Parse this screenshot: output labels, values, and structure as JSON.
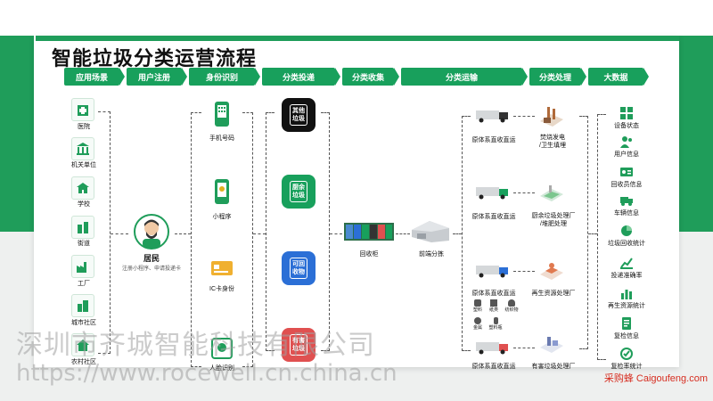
{
  "title": "智能垃圾分类运营流程",
  "colors": {
    "green": "#18a05c",
    "dark": "#111111",
    "blue": "#2b6fd6",
    "red": "#e05050"
  },
  "headers": [
    "应用场景",
    "用户注册",
    "身份识别",
    "分类投递",
    "分类收集",
    "分类运输",
    "分类处理",
    "大数据"
  ],
  "scenes": [
    "医院",
    "机关单位",
    "学校",
    "街道",
    "工厂",
    "城市社区",
    "农村社区"
  ],
  "resident": {
    "name": "居民",
    "desc": "注册小程序、申请投递卡"
  },
  "identity": [
    "手机号码",
    "小程序",
    "IC卡身份",
    "人脸识别"
  ],
  "bins": [
    {
      "label": "其他\n垃圾",
      "color": "#111111"
    },
    {
      "label": "厨余\n垃圾",
      "color": "#18a05c"
    },
    {
      "label": "可回\n收物",
      "color": "#2b6fd6"
    },
    {
      "label": "有害\n垃圾",
      "color": "#e05050"
    }
  ],
  "collect": {
    "station": "回收柜",
    "sorting": "前端分拣"
  },
  "transport": [
    "原体系直收直运",
    "原体系直收直运",
    "原体系直收直运",
    "原体系直收直运"
  ],
  "recycle_items": [
    "塑料",
    "纸类",
    "纺织物",
    "金属",
    "塑料瓶"
  ],
  "process": [
    "焚烧发电\n/卫生填埋",
    "厨余垃圾处理厂\n/堆肥处理",
    "再生资源处理厂",
    "有害垃圾处理厂"
  ],
  "bigdata": [
    "设备状态",
    "用户信息",
    "回收员信息",
    "车辆信息",
    "垃圾回收统计",
    "投递准确率",
    "再生资源统计",
    "复检信息",
    "复检率统计"
  ],
  "watermark": {
    "line1": "深圳市齐城智能科技有限公司",
    "line2": "https://www.rocewell.cn.china.cn"
  },
  "brand": "采购蜂 Caigoufeng.com"
}
